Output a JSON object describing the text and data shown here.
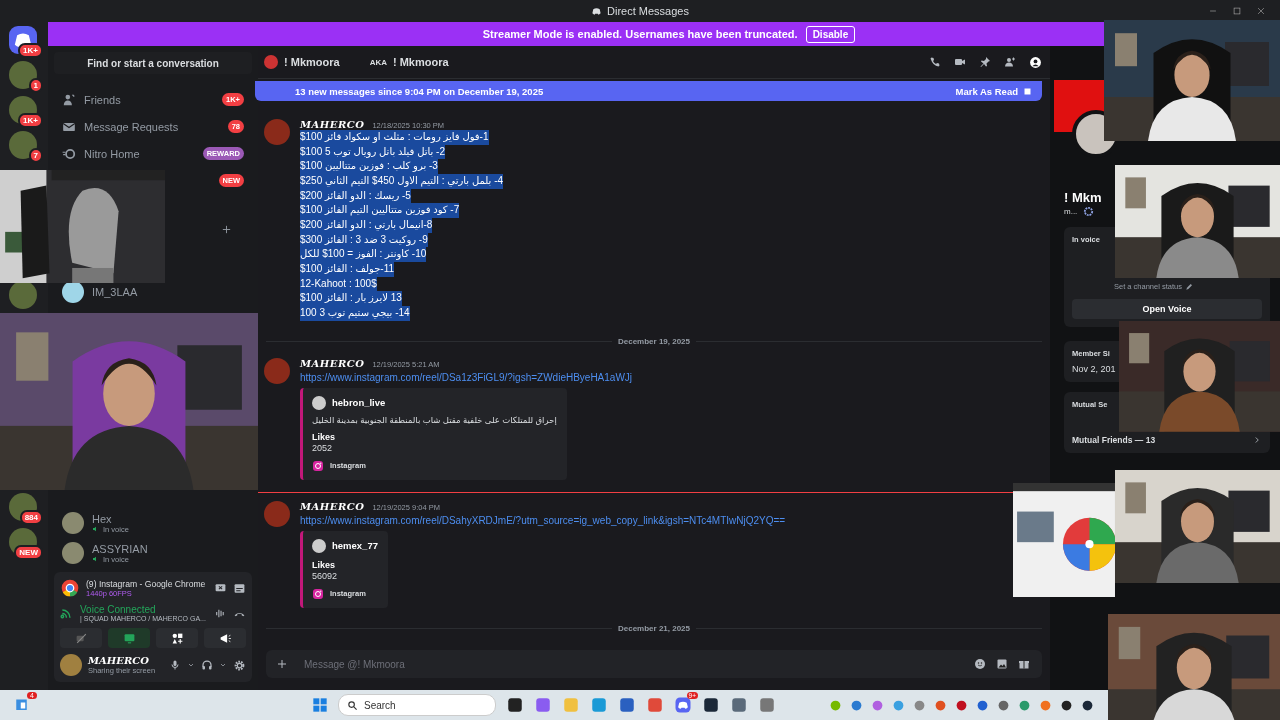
{
  "title_bar": {
    "title": "Direct Messages"
  },
  "banner": {
    "text": "Streamer Mode is enabled. Usernames have been truncated.",
    "button": "Disable"
  },
  "server_rail": {
    "top": [
      {
        "kind": "home",
        "badge": "1K+"
      },
      {
        "kind": "server",
        "badge": "1"
      },
      {
        "kind": "server",
        "badge": "1K+"
      },
      {
        "kind": "server",
        "badge": "7"
      }
    ],
    "middle": [
      {
        "kind": "server"
      }
    ],
    "bottom": [
      {
        "kind": "server",
        "badge": "884"
      },
      {
        "kind": "server",
        "badge": "NEW"
      }
    ]
  },
  "sidebar": {
    "search": "Find or start a conversation",
    "items": [
      {
        "kind": "friends",
        "label": "Friends",
        "badge": "1K+",
        "color": "#f23f43"
      },
      {
        "kind": "requests",
        "label": "Message Requests",
        "badge": "78",
        "color": "#f23f43"
      },
      {
        "kind": "nitro",
        "label": "Nitro Home",
        "badge": "REWARD",
        "color": "#9b59b6"
      },
      {
        "kind": "hidden",
        "badge": "NEW",
        "color": "#f23f43"
      }
    ],
    "direct_messages": [
      {
        "name": "IM_3LAA"
      }
    ],
    "direct_messages_lower": [
      {
        "name": "Hex",
        "status": "In voice"
      },
      {
        "name": "ASSYRIAN",
        "status": "In voice"
      }
    ]
  },
  "stream_panel": {
    "title": "(9) Instagram - Google Chrome",
    "quality": "1440p 60FPS",
    "voice_status": "Voice Connected",
    "channel": "| SQUAD MAHERCO / MAHERCO GA..."
  },
  "user_panel": {
    "name": "MAHERCO",
    "status": "Sharing their screen"
  },
  "chat_header": {
    "name": "! Mkmoora",
    "aka_label": "AKA",
    "aka": "! Mkmoora"
  },
  "new_messages_bar": {
    "text": "13 new messages since 9:04 PM on December 19, 2025",
    "action": "Mark As Read"
  },
  "messages": [
    {
      "kind": "message",
      "author": "MAHERCO",
      "time": "12/18/2025 10:30 PM",
      "selected": true,
      "new_marker": false,
      "lines": [
        "1-فول فايز رومات : مثلث او سكواد فائز 100$",
        "2- باتل فيلد باتل رويال توب 5 100$",
        "3- برو كلب : فوزين متتاليين 100$",
        "4- بلمل بارتي : التيم الاول 450$ التيم الثاني 250$",
        "5- ريسك : الدو الفائز 200$",
        "7- كود فوزين متتاليين التيم الفائز 100$",
        "8-انيمال بارتي : الدو الفائز 200$",
        "9- روكيت 3 ضد 3 : الفائز 300$",
        "10- كاونتر : الفوز = 100$ للكل",
        "11-جولف : الفائز 100$",
        "12-Kahoot : 100$",
        "13 لايرز بار : الفائز 100$",
        "14- بيجي ستيم توب 3 100"
      ]
    },
    {
      "kind": "date",
      "text": "December 19, 2025"
    },
    {
      "kind": "message",
      "author": "MAHERCO",
      "time": "12/19/2025 5:21 AM",
      "new_marker": false,
      "link": "https://www.instagram.com/reel/DSa1z3FiGL9/?igsh=ZWdieHByeHA1aWJj",
      "embed": {
        "author": "hebron_live",
        "description": "إحراق للمتلكات على خلفية مقتل شاب بالمنطقة الجنوبية بمدينة الخليل",
        "field_name": "Likes",
        "field_value": "2052",
        "footer": "Instagram"
      }
    },
    {
      "kind": "message",
      "author": "MAHERCO",
      "time": "12/19/2025 9:04 PM",
      "new_marker": true,
      "link": "https://www.instagram.com/reel/DSahyXRDJmE/?utm_source=ig_web_copy_link&igsh=NTc4MTIwNjQ2YQ==",
      "embed": {
        "author": "hemex_77",
        "field_name": "Likes",
        "field_value": "56092",
        "footer": "Instagram"
      }
    },
    {
      "kind": "date",
      "text": "December 21, 2025"
    }
  ],
  "composer": {
    "placeholder": "Message @! Mkmoora"
  },
  "profile": {
    "name": "! Mkm",
    "tag": "m...",
    "in_voice_title": "In voice",
    "channel_status": "Set a channel status",
    "open_voice": "Open Voice",
    "member_since_title": "Member Si",
    "member_since": "Nov 2, 201",
    "mutual_servers": "Mutual Se",
    "mutual_friends": "Mutual Friends — 13"
  },
  "taskbar": {
    "widget_badge": "4",
    "search": "Search",
    "discord_badge": "9+"
  }
}
